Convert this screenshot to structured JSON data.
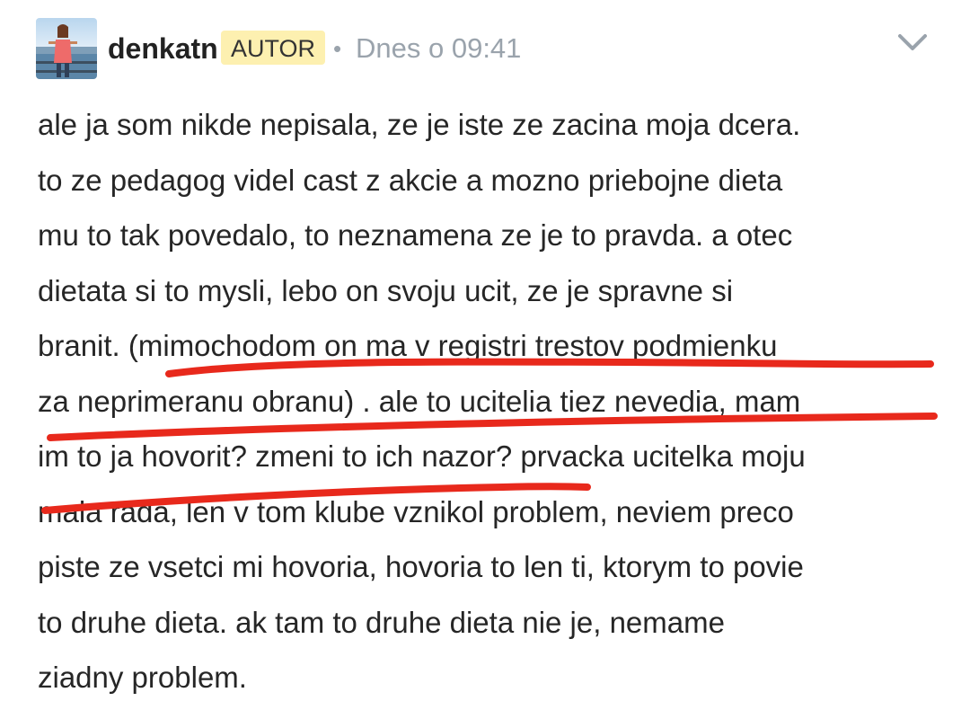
{
  "post": {
    "author": {
      "username": "denkatn",
      "badge": "AUTOR"
    },
    "separator": "•",
    "timestamp": "Dnes o 09:41",
    "body": "ale ja som nikde nepisala, ze je iste ze zacina moja dcera.\nto ze pedagog videl cast z akcie a mozno priebojne dieta\nmu to tak povedalo, to neznamena ze je to pravda. a otec\ndietata si to mysli, lebo on svoju ucit, ze je spravne si\nbranit. (mimochodom on ma v registri trestov podmienku\nza neprimeranu obranu) . ale to ucitelia tiez nevedia, mam\nim to ja hovorit? zmeni to ich nazor? prvacka ucitelka moju\nmala rada, len v tom klube vznikol problem, neviem preco\npiste ze vsetci mi hovoria, hovoria to len ti, ktorym to povie\nto druhe dieta. ak tam to druhe dieta nie je, nemame\nziadny problem."
  },
  "icons": {
    "menu": "chevron-down-icon"
  },
  "colors": {
    "badge_bg": "#fdf0b0",
    "underline": "#e8291c",
    "muted_text": "#9aa3ac",
    "body_text": "#262626"
  }
}
